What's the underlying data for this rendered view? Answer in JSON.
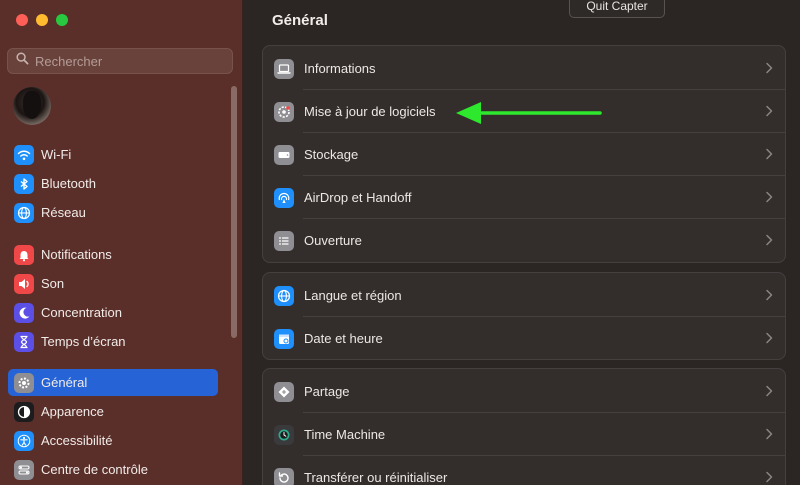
{
  "sidebar": {
    "search_placeholder": "Rechercher",
    "items": [
      {
        "label": "Wi-Fi",
        "icon": "wifi-icon",
        "color": "#1e8ffb"
      },
      {
        "label": "Bluetooth",
        "icon": "bluetooth-icon",
        "color": "#1e8ffb"
      },
      {
        "label": "Réseau",
        "icon": "globe-icon",
        "color": "#1e8ffb"
      },
      {
        "label": "Notifications",
        "icon": "bell-icon",
        "color": "#f04848"
      },
      {
        "label": "Son",
        "icon": "speaker-icon",
        "color": "#f04848"
      },
      {
        "label": "Concentration",
        "icon": "moon-icon",
        "color": "#5b4fe6"
      },
      {
        "label": "Temps d’écran",
        "icon": "hourglass-icon",
        "color": "#5b4fe6"
      },
      {
        "label": "Général",
        "icon": "gear-icon",
        "color": "#8e8e93"
      },
      {
        "label": "Apparence",
        "icon": "appearance-icon",
        "color": "#1c1c1e"
      },
      {
        "label": "Accessibilité",
        "icon": "accessibility-icon",
        "color": "#1e8ffb"
      },
      {
        "label": "Centre de contrôle",
        "icon": "control-center-icon",
        "color": "#8e8e93"
      }
    ]
  },
  "main": {
    "title": "Général",
    "tooltip": "Quit Capter",
    "groups": [
      {
        "rows": [
          {
            "label": "Informations",
            "icon": "laptop-icon",
            "color": "#8e8e93"
          },
          {
            "label": "Mise à jour de logiciels",
            "icon": "software-update-icon",
            "color": "#8e8e93"
          },
          {
            "label": "Stockage",
            "icon": "storage-icon",
            "color": "#8e8e93"
          },
          {
            "label": "AirDrop et Handoff",
            "icon": "airdrop-icon",
            "color": "#1e8ffb"
          },
          {
            "label": "Ouverture",
            "icon": "list-icon",
            "color": "#8e8e93"
          }
        ]
      },
      {
        "rows": [
          {
            "label": "Langue et région",
            "icon": "globe-icon",
            "color": "#1e8ffb"
          },
          {
            "label": "Date et heure",
            "icon": "calendar-icon",
            "color": "#1e8ffb"
          }
        ]
      },
      {
        "rows": [
          {
            "label": "Partage",
            "icon": "sharing-icon",
            "color": "#8e8e93"
          },
          {
            "label": "Time Machine",
            "icon": "time-machine-icon",
            "color": "#3a3a3c"
          },
          {
            "label": "Transférer ou réinitialiser",
            "icon": "reset-icon",
            "color": "#8e8e93"
          }
        ]
      }
    ]
  },
  "colors": {
    "annotation_arrow": "#2ee82e",
    "selection": "#2563d6"
  }
}
